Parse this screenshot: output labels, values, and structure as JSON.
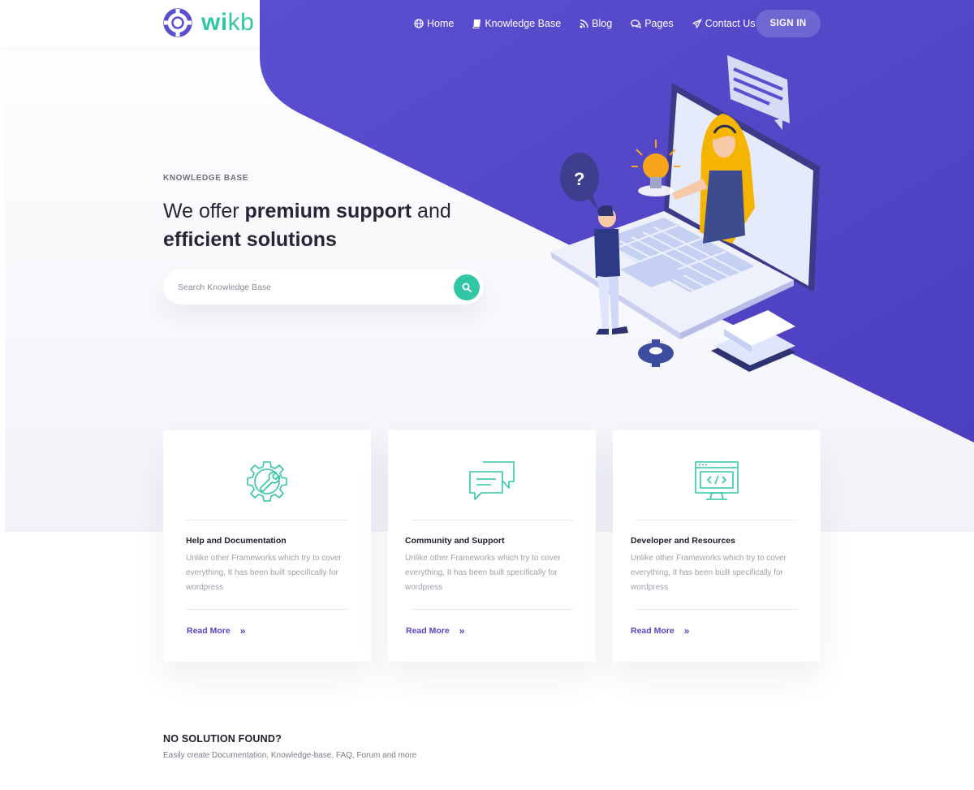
{
  "brand": {
    "logo_part1": "wi",
    "logo_part2": "kb",
    "accent": "#33c6a3",
    "primary": "#5246c3"
  },
  "nav": {
    "items": [
      {
        "label": "Home",
        "icon": "globe-icon"
      },
      {
        "label": "Knowledge Base",
        "icon": "book-icon"
      },
      {
        "label": "Blog",
        "icon": "rss-icon"
      },
      {
        "label": "Pages",
        "icon": "comments-icon"
      },
      {
        "label": "Contact Us",
        "icon": "paper-plane-icon"
      }
    ],
    "signin_label": "SIGN IN"
  },
  "hero": {
    "eyebrow": "KNOWLEDGE BASE",
    "headline_part1": "We offer ",
    "headline_bold1": "premium support",
    "headline_part2": " and ",
    "headline_bold2": "efficient solutions",
    "search_placeholder": "Search Knowledge Base"
  },
  "cards": [
    {
      "icon": "gear-wrench-icon",
      "title": "Help and Documentation",
      "desc": "Unlike other Frameworks which try to cover everything, It has been built specifically for wordpress",
      "link": "Read More"
    },
    {
      "icon": "chat-bubbles-icon",
      "title": "Community and Support",
      "desc": "Unlike other Frameworks which try to cover everything, It has been built specifically for wordpress",
      "link": "Read More"
    },
    {
      "icon": "code-window-icon",
      "title": "Developer and Resources",
      "desc": "Unlike other Frameworks which try to cover everything, It has been built specifically for wordpress",
      "link": "Read More"
    }
  ],
  "bottom": {
    "title": "NO SOLUTION FOUND?",
    "subtitle": "Easily create Documentation, Knowledge-base, FAQ, Forum and more"
  }
}
